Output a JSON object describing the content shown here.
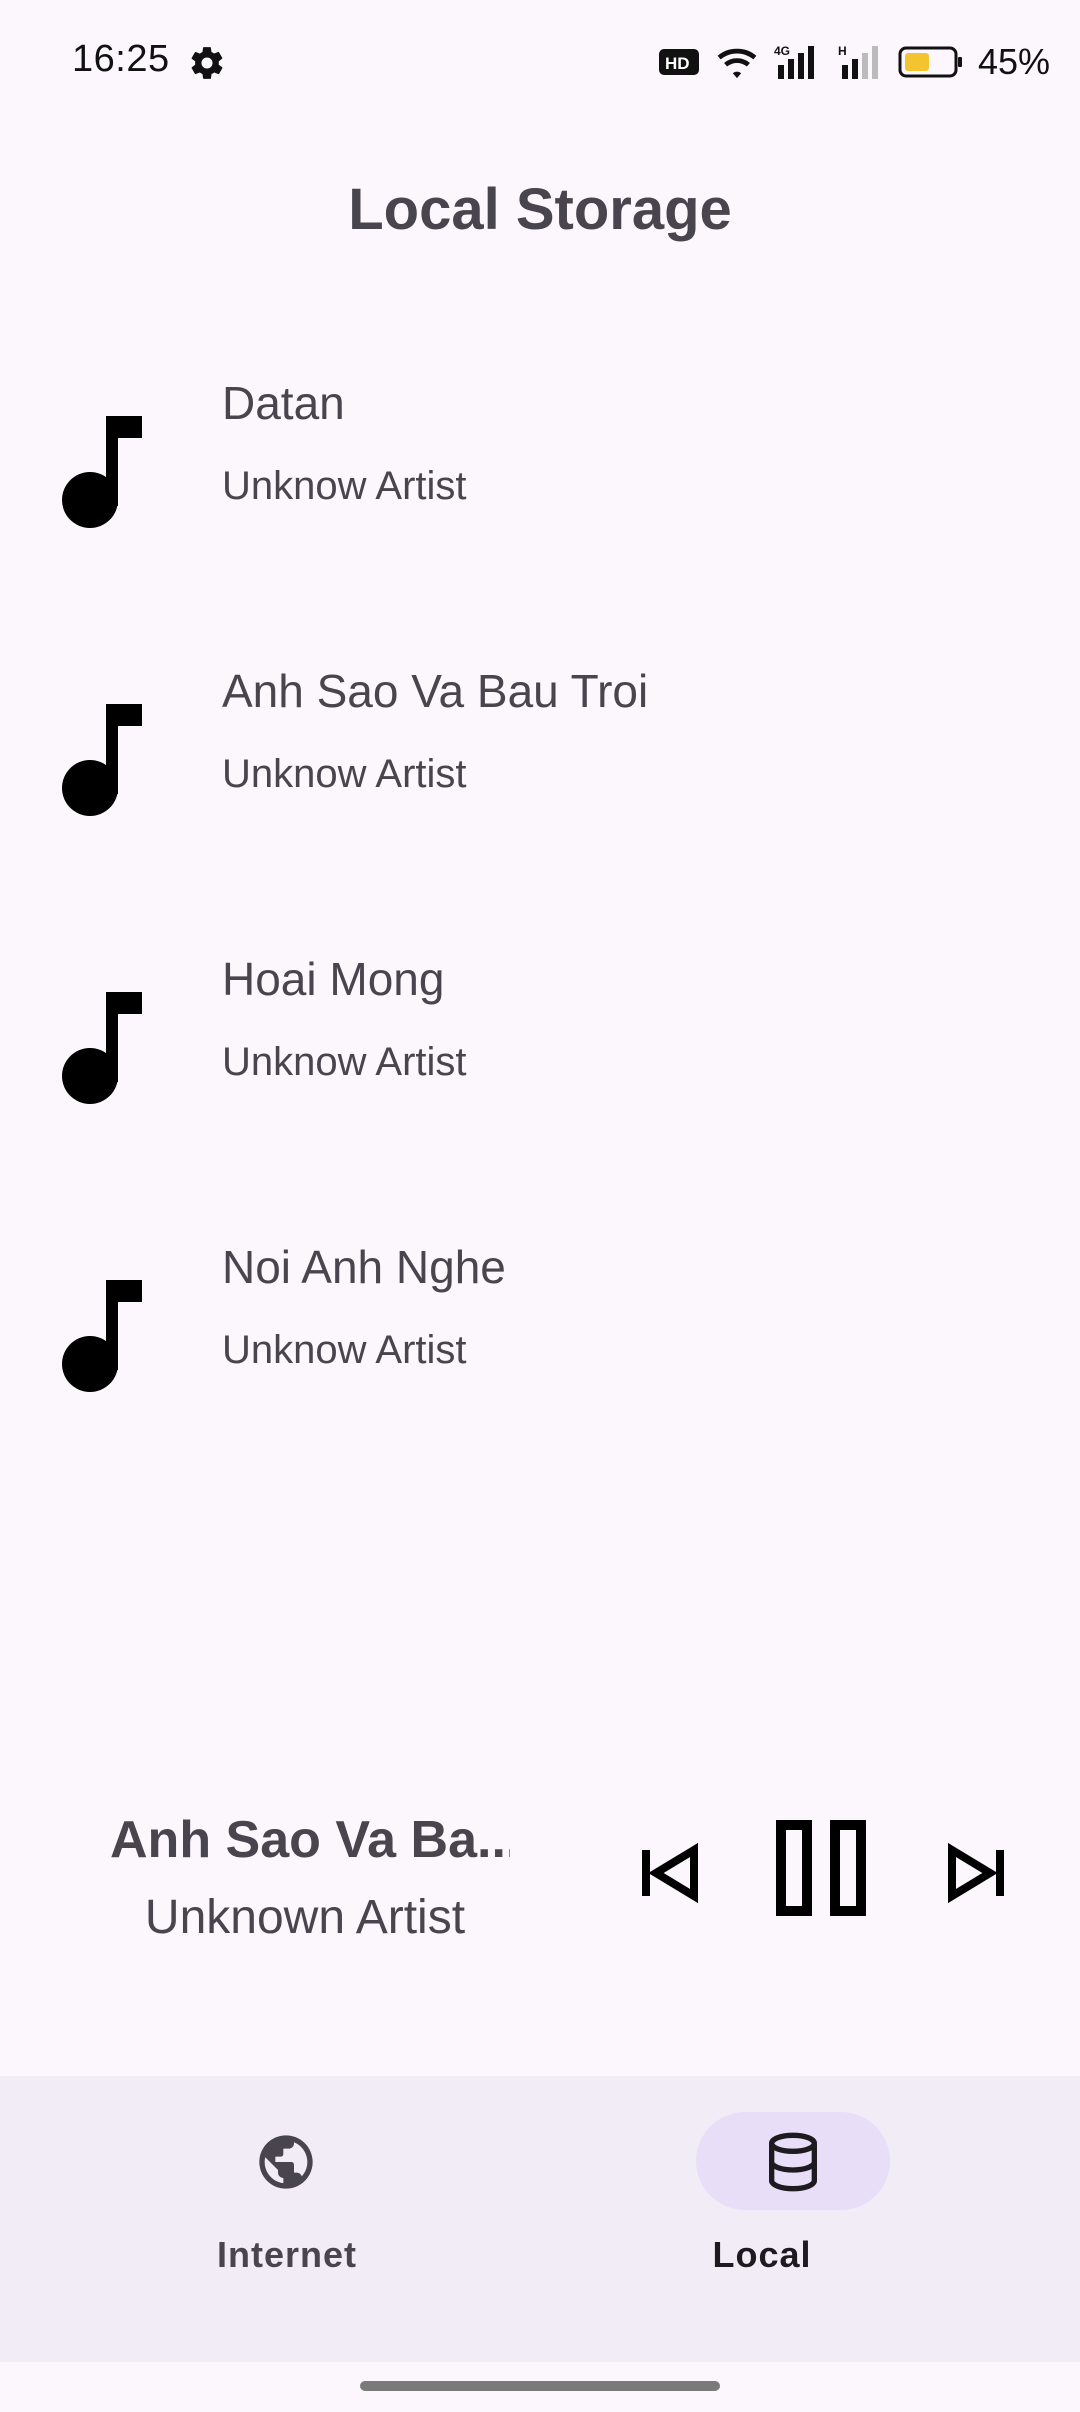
{
  "status_bar": {
    "time": "16:25",
    "battery": "45%",
    "icons": [
      "settings-gear-icon",
      "hd-icon",
      "wifi-icon",
      "4g-signal-icon",
      "signal-icon",
      "battery-icon"
    ]
  },
  "page": {
    "title": "Local Storage"
  },
  "songs": [
    {
      "title": "Datan",
      "artist": "Unknow Artist",
      "icon": "music-note-icon"
    },
    {
      "title": "Anh Sao Va Bau Troi",
      "artist": "Unknow Artist",
      "icon": "music-note-icon"
    },
    {
      "title": "Hoai Mong",
      "artist": "Unknow Artist",
      "icon": "music-note-icon"
    },
    {
      "title": "Noi Anh Nghe",
      "artist": "Unknow Artist",
      "icon": "music-note-icon"
    }
  ],
  "now_playing": {
    "title": "Anh Sao Va Ba...",
    "artist": "Unknown Artist",
    "controls": [
      "skip-previous-icon",
      "pause-icon",
      "skip-next-icon"
    ]
  },
  "bottom_nav": {
    "items": [
      {
        "label": "Internet",
        "icon": "globe-icon",
        "active": false
      },
      {
        "label": "Local",
        "icon": "database-icon",
        "active": true
      }
    ]
  },
  "colors": {
    "background": "#fcf7fc",
    "text": "#49454f",
    "nav_background": "#f2ecf6",
    "nav_active_pill": "#e8def8",
    "battery_fill": "#f4c430"
  }
}
